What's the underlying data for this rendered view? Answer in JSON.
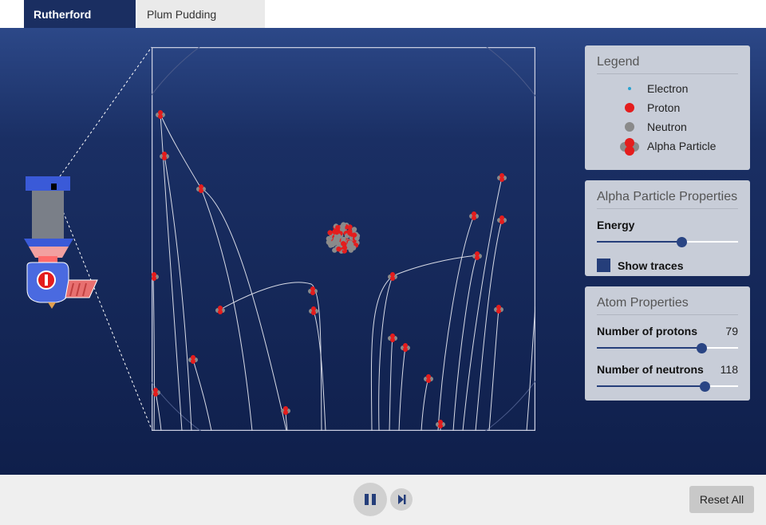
{
  "tabs": [
    {
      "label": "Rutherford Atom",
      "symbol": "−",
      "active": true
    },
    {
      "label": "Plum Pudding Atom",
      "symbol": "+",
      "active": false
    }
  ],
  "legend": {
    "title": "Legend",
    "items": [
      {
        "label": "Electron",
        "icon": "electron-icon"
      },
      {
        "label": "Proton",
        "icon": "proton-icon"
      },
      {
        "label": "Neutron",
        "icon": "neutron-icon"
      },
      {
        "label": "Alpha Particle",
        "icon": "alpha-particle-icon"
      }
    ]
  },
  "alpha_panel": {
    "title": "Alpha Particle Properties",
    "energy_label": "Energy",
    "energy_fraction": 0.6,
    "show_traces_label": "Show traces",
    "show_traces_checked": true
  },
  "atom_panel": {
    "title": "Atom Properties",
    "protons_label": "Number of protons",
    "protons_value": "79",
    "protons_fraction": 0.74,
    "neutrons_label": "Number of neutrons",
    "neutrons_value": "118",
    "neutrons_fraction": 0.76
  },
  "controls": {
    "pause_icon": "pause-icon",
    "step_icon": "step-forward-icon",
    "reset_label": "Reset All"
  },
  "colors": {
    "proton": "#e41d1d",
    "neutron": "#8a8a8a",
    "electron": "#29a3d1",
    "accent": "#253e7a"
  }
}
